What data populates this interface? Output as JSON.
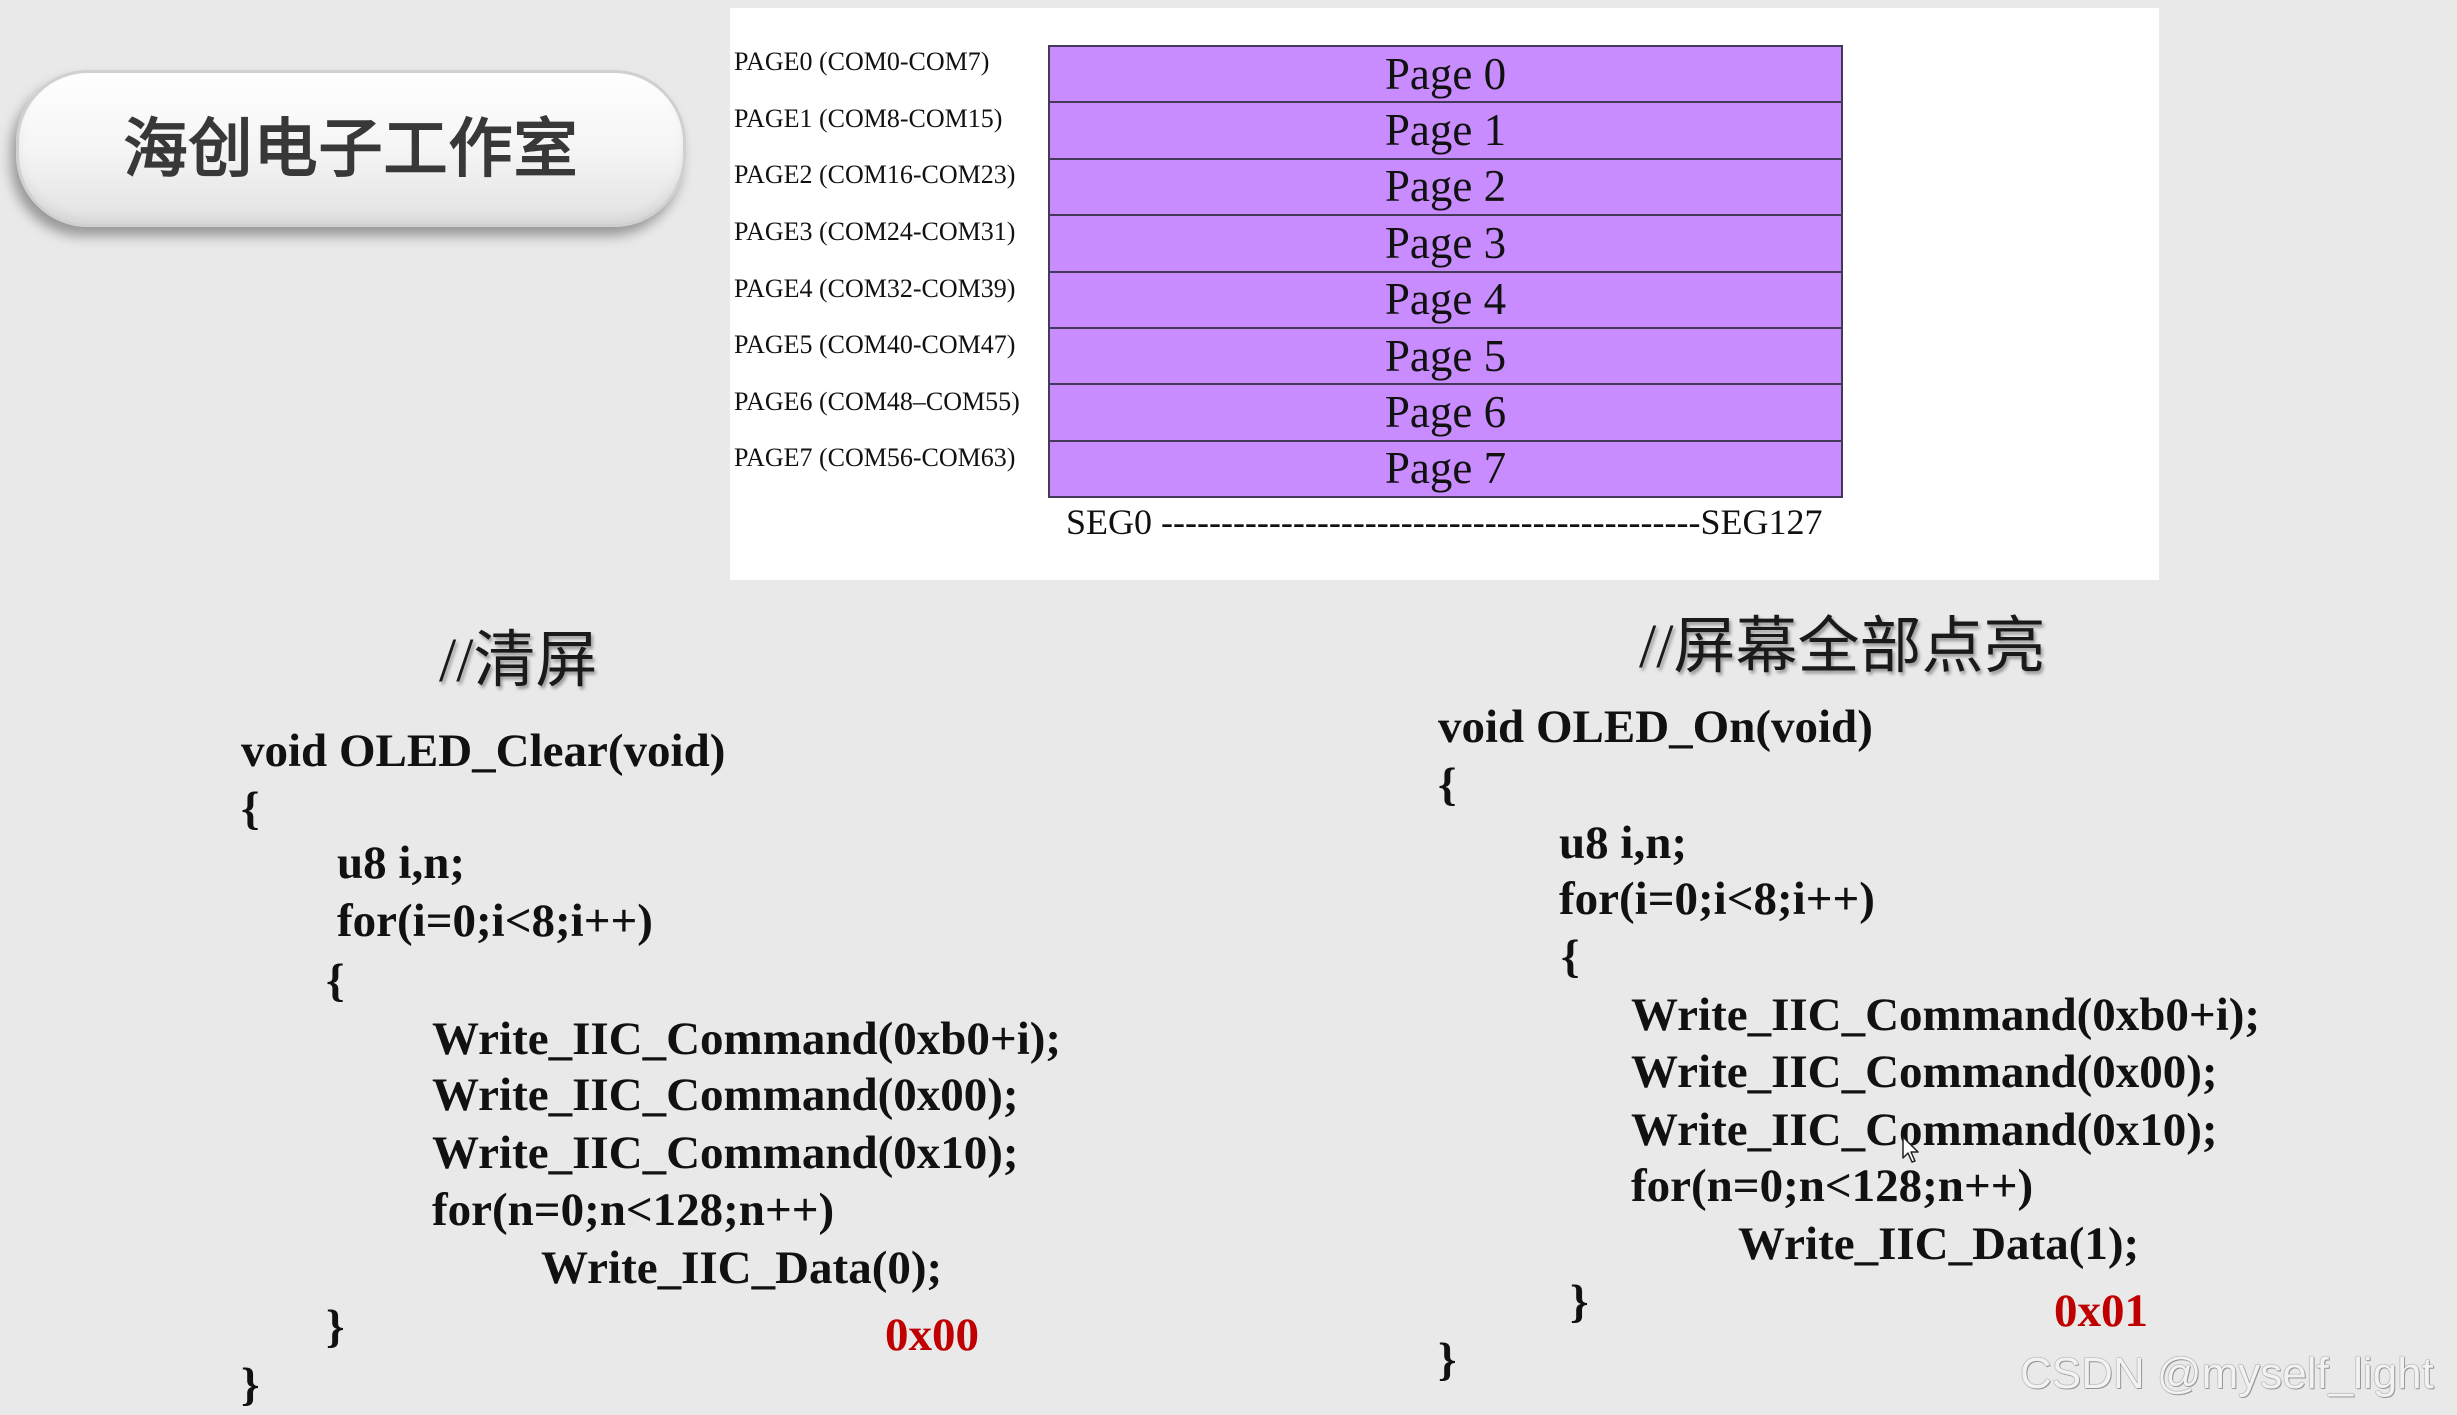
{
  "title_badge": {
    "text": "海创电子工作室"
  },
  "diagram": {
    "pages": [
      {
        "com_range": "PAGE0 (COM0-COM7)",
        "row_label": "Page 0"
      },
      {
        "com_range": "PAGE1 (COM8-COM15)",
        "row_label": "Page 1"
      },
      {
        "com_range": "PAGE2 (COM16-COM23)",
        "row_label": "Page 2"
      },
      {
        "com_range": "PAGE3 (COM24-COM31)",
        "row_label": "Page 3"
      },
      {
        "com_range": "PAGE4 (COM32-COM39)",
        "row_label": "Page 4"
      },
      {
        "com_range": "PAGE5 (COM40-COM47)",
        "row_label": "Page 5"
      },
      {
        "com_range": "PAGE6 (COM48–COM55)",
        "row_label": "Page 6"
      },
      {
        "com_range": "PAGE7 (COM56-COM63)",
        "row_label": "Page 7"
      }
    ],
    "segment_axis": "SEG0 ---------------------------------------------SEG127"
  },
  "clear_code": {
    "comment": "//清屏",
    "lines": [
      "void OLED_Clear(void)",
      "{",
      "u8 i,n;",
      "for(i=0;i<8;i++)",
      "{",
      "Write_IIC_Command(0xb0+i);",
      "Write_IIC_Command(0x00);",
      "Write_IIC_Command(0x10);",
      "for(n=0;n<128;n++)",
      "Write_IIC_Data(0);",
      "}",
      "}"
    ],
    "value_note": "0x00"
  },
  "on_code": {
    "comment": "//屏幕全部点亮",
    "lines": [
      "void OLED_On(void)",
      "{",
      "u8 i,n;",
      "for(i=0;i<8;i++)",
      "{",
      "Write_IIC_Command(0xb0+i);",
      "Write_IIC_Command(0x00);",
      "Write_IIC_Command(0x10);",
      "for(n=0;n<128;n++)",
      "Write_IIC_Data(1);",
      "}",
      "}"
    ],
    "value_note": "0x01"
  },
  "watermark": "CSDN @myself_light",
  "icons": {
    "pointer": "mouse-pointer-icon"
  },
  "colors": {
    "background": "#e9e9e9",
    "page_fill": "#c98cff",
    "page_border": "#44395a",
    "value_note": "#c00000",
    "code_text": "#111111"
  }
}
